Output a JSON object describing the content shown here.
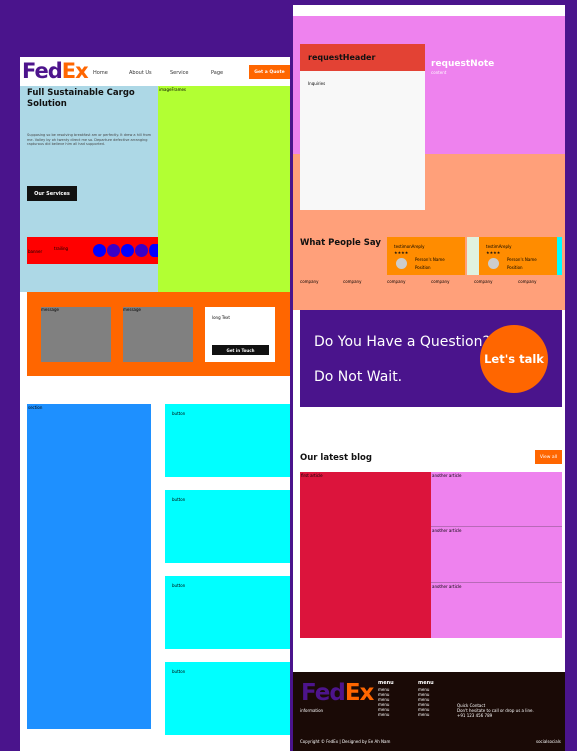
{
  "left_page": {
    "nav": {
      "logo_fed": "Fed",
      "logo_ex": "Ex",
      "links": [
        "Home",
        "About Us",
        "Service",
        "Page"
      ],
      "quote_button": "Get a Quote"
    },
    "hero": {
      "title_line1": "Full Sustainable Cargo",
      "title_line2": "Solution",
      "text": "Supposing so be resolving breakfast am or perfectly. It drew a hill from me. Valley by oh twenty direct me so. Departure defective arranging rapturous did believe him all had supported.",
      "services_button": "Our Services",
      "image_frames_label": "imageFrames"
    },
    "banner": {
      "left_label": "banner",
      "middle_label": "trailing"
    },
    "message_strip": {
      "message1_label": "message",
      "message2_label": "message",
      "long_text": "long Text",
      "touch_button": "Get in Touch"
    },
    "sections": {
      "big_label": "section",
      "button_labels": [
        "button",
        "button",
        "button",
        "button"
      ]
    }
  },
  "right_page": {
    "request": {
      "header": "requestHeader",
      "sub_label": "Inquiries",
      "note": "requestNote",
      "note_small": "content"
    },
    "testimonials": {
      "title": "What People Say",
      "cards": [
        {
          "label": "testimonAreply",
          "stars": "★★★★",
          "name": "Person's Name",
          "position": "Position"
        },
        {
          "label": "testimAreply",
          "stars": "★★★★",
          "name": "Person's Name",
          "position": "Position"
        }
      ],
      "companies": [
        "company",
        "company",
        "company",
        "company",
        "company",
        "company"
      ]
    },
    "question": {
      "line1": "Do You Have a Question?",
      "line2": "Do Not Wait.",
      "talk_button": "Let's talk"
    },
    "blog": {
      "title": "Our latest blog",
      "view_all": "View all",
      "main_article": "first article",
      "side_articles": [
        "another article",
        "another article",
        "another article"
      ]
    },
    "footer": {
      "logo_fed": "Fed",
      "logo_ex": "Ex",
      "information": "information",
      "menu_title_1": "menu",
      "menu_title_2": "menu",
      "menu_items_1": [
        "menu",
        "menu",
        "menu",
        "menu",
        "menu",
        "menu"
      ],
      "menu_items_2": [
        "menu",
        "menu",
        "menu",
        "menu",
        "menu",
        "menu"
      ],
      "contact_title": "Quick Contact",
      "contact_text": "Don't hesitate to call or drop us a line.",
      "phone": "+91 123 456 789",
      "copyright": "Copyright © FedEx | Designed by Ee Ah Nam",
      "socials": "socialsocials"
    }
  },
  "colors": {
    "background": "#4a148c",
    "fedex_purple": "#4d148c",
    "fedex_orange": "#ff6600"
  }
}
